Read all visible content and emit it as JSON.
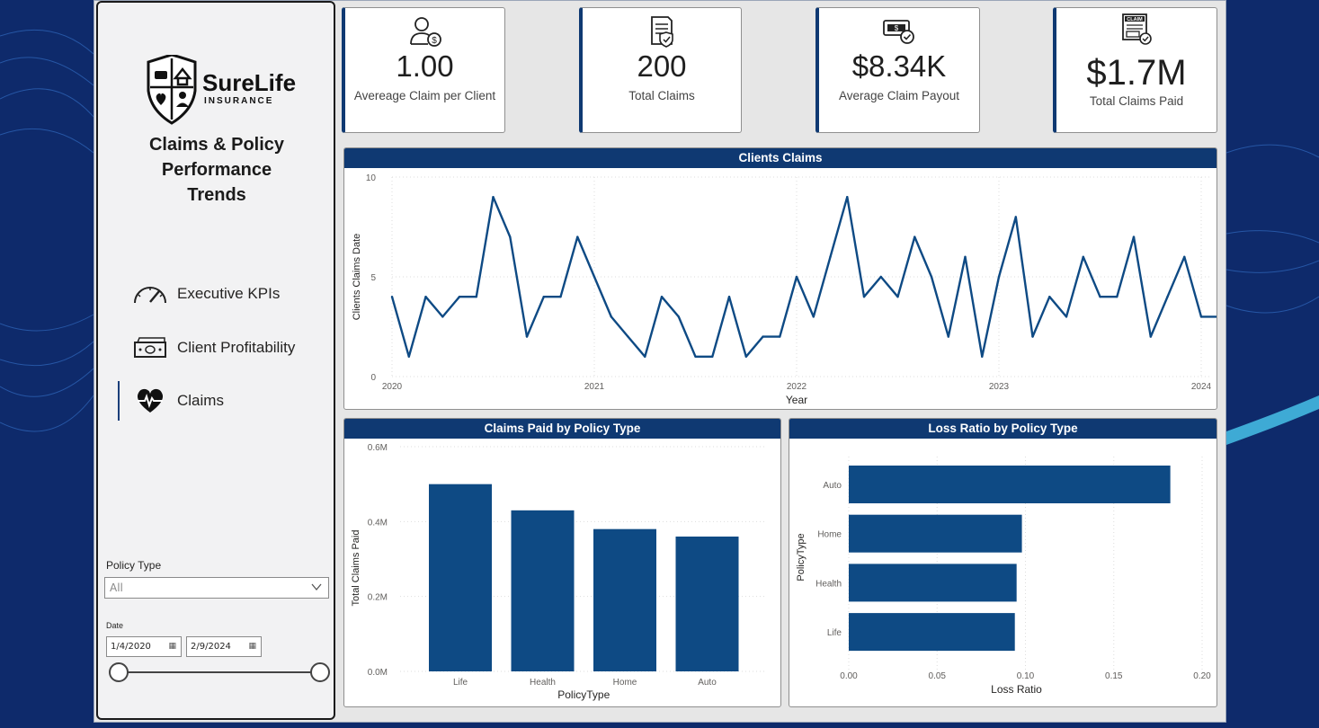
{
  "brand": {
    "name": "SureLife",
    "tagline": "INSURANCE"
  },
  "page": {
    "title_lines": [
      "Claims & Policy",
      "Performance",
      "Trends"
    ]
  },
  "nav": {
    "items": [
      {
        "label": "Executive KPIs",
        "icon": "speedometer-icon",
        "active": false
      },
      {
        "label": "Client Profitability",
        "icon": "money-bill-icon",
        "active": false
      },
      {
        "label": "Claims",
        "icon": "heartbeat-icon",
        "active": true
      }
    ]
  },
  "filters": {
    "policy_type_label": "Policy Type",
    "policy_type_value": "All",
    "date_label": "Date",
    "date_start": "1/4/2020",
    "date_end": "2/9/2024"
  },
  "kpis": [
    {
      "value": "1.00",
      "label": "Avereage Claim per Client",
      "icon": "user-dollar-icon"
    },
    {
      "value": "200",
      "label": "Total Claims",
      "icon": "document-shield-icon"
    },
    {
      "value": "$8.34K",
      "label": "Average Claim Payout",
      "icon": "cash-check-icon"
    },
    {
      "value": "$1.7M",
      "label": "Total Claims Paid",
      "icon": "claim-form-icon"
    }
  ],
  "colors": {
    "primary": "#0f3972",
    "series": "#0e4a84",
    "background": "#0e2a6b"
  },
  "chart_data": [
    {
      "type": "line",
      "title": "Clients Claims",
      "xlabel": "Year",
      "ylabel": "Clients Claims Date",
      "x_ticks": [
        "2020",
        "2021",
        "2022",
        "2023",
        "2024"
      ],
      "x_range": [
        "2020-01",
        "2024-02"
      ],
      "ylim": [
        0,
        10
      ],
      "y_ticks": [
        0,
        5,
        10
      ],
      "grid": true,
      "x": [
        "2020-01",
        "2020-02",
        "2020-03",
        "2020-04",
        "2020-05",
        "2020-06",
        "2020-07",
        "2020-08",
        "2020-09",
        "2020-10",
        "2020-11",
        "2020-12",
        "2021-01",
        "2021-02",
        "2021-03",
        "2021-04",
        "2021-05",
        "2021-06",
        "2021-07",
        "2021-08",
        "2021-09",
        "2021-10",
        "2021-11",
        "2021-12",
        "2022-01",
        "2022-02",
        "2022-03",
        "2022-04",
        "2022-05",
        "2022-06",
        "2022-07",
        "2022-08",
        "2022-09",
        "2022-10",
        "2022-11",
        "2022-12",
        "2023-01",
        "2023-02",
        "2023-03",
        "2023-04",
        "2023-05",
        "2023-06",
        "2023-07",
        "2023-08",
        "2023-09",
        "2023-10",
        "2023-11",
        "2023-12",
        "2024-01",
        "2024-02"
      ],
      "values": [
        4,
        1,
        4,
        3,
        4,
        4,
        9,
        7,
        2,
        4,
        4,
        7,
        5,
        3,
        2,
        1,
        4,
        3,
        1,
        1,
        4,
        1,
        2,
        2,
        5,
        3,
        6,
        9,
        4,
        5,
        4,
        7,
        5,
        2,
        6,
        1,
        5,
        8,
        2,
        4,
        3,
        6,
        4,
        4,
        7,
        2,
        4,
        6,
        3,
        3
      ]
    },
    {
      "type": "bar",
      "title": "Claims Paid by Policy Type",
      "xlabel": "PolicyType",
      "ylabel": "Total Claims Paid",
      "categories": [
        "Life",
        "Health",
        "Home",
        "Auto"
      ],
      "values": [
        0.5,
        0.43,
        0.38,
        0.36
      ],
      "unit": "M",
      "ylim": [
        0,
        0.6
      ],
      "y_ticks": [
        "0.0M",
        "0.2M",
        "0.4M",
        "0.6M"
      ],
      "grid": true
    },
    {
      "type": "bar",
      "orientation": "horizontal",
      "title": "Loss Ratio by Policy Type",
      "xlabel": "Loss Ratio",
      "ylabel": "PolicyType",
      "categories": [
        "Auto",
        "Home",
        "Health",
        "Life"
      ],
      "values": [
        0.182,
        0.098,
        0.095,
        0.094
      ],
      "xlim": [
        0,
        0.2
      ],
      "x_ticks": [
        "0.00",
        "0.05",
        "0.10",
        "0.15",
        "0.20"
      ],
      "grid": true
    }
  ]
}
